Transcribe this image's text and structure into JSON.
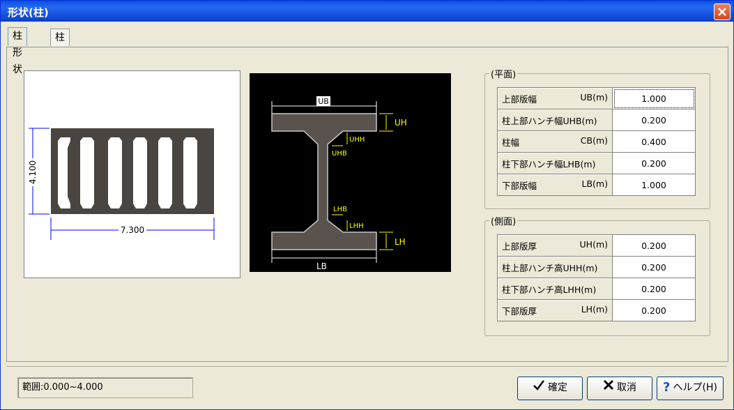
{
  "window": {
    "title": "形状(柱)"
  },
  "tabs": [
    {
      "label": "柱形状"
    },
    {
      "label": "柱データ数"
    }
  ],
  "preview_left": {
    "width_label": "7.300",
    "height_label": "4.100"
  },
  "preview_right": {
    "labels": {
      "ub": "UB",
      "uh": "UH",
      "uhh": "UHH",
      "uhb": "UHB",
      "lhb": "LHB",
      "lhh": "LHH",
      "lh": "LH",
      "lb": "LB"
    }
  },
  "plane": {
    "title": "(平面)",
    "rows": [
      {
        "label": "上部版幅",
        "unit": "UB(m)",
        "value": "1.000"
      },
      {
        "label": "柱上部ハンチ幅UHB(m)",
        "unit": "",
        "value": "0.200"
      },
      {
        "label": "柱幅",
        "unit": "CB(m)",
        "value": "0.400"
      },
      {
        "label": "柱下部ハンチ幅LHB(m)",
        "unit": "",
        "value": "0.200"
      },
      {
        "label": "下部版幅",
        "unit": "LB(m)",
        "value": "1.000"
      }
    ]
  },
  "side": {
    "title": "(側面)",
    "rows": [
      {
        "label": "上部版厚",
        "unit": "UH(m)",
        "value": "0.200"
      },
      {
        "label": "柱上部ハンチ高UHH(m)",
        "unit": "",
        "value": "0.200"
      },
      {
        "label": "柱下部ハンチ高LHH(m)",
        "unit": "",
        "value": "0.200"
      },
      {
        "label": "下部版厚",
        "unit": "LH(m)",
        "value": "0.200"
      }
    ]
  },
  "status": {
    "range": "範囲:0.000~4.000"
  },
  "buttons": {
    "ok": "確定",
    "cancel": "取消",
    "help": "ヘルプ(H)"
  },
  "colors": {
    "title_bar": "#0a4fe0",
    "shape_fill": "#4a4540",
    "dim_yellow": "#ffff00"
  }
}
